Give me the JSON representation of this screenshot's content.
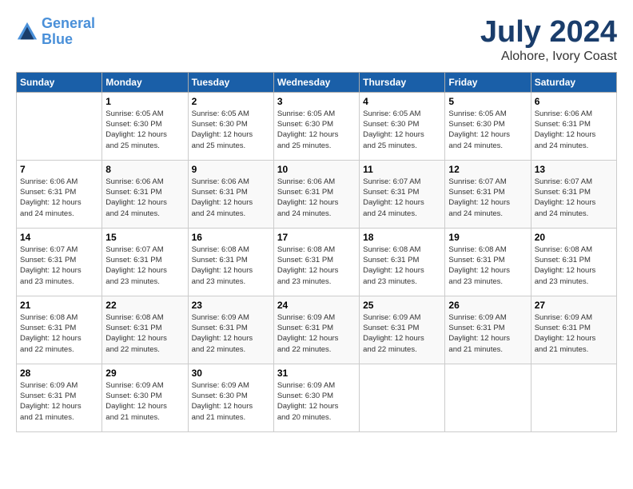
{
  "header": {
    "logo_line1": "General",
    "logo_line2": "Blue",
    "month": "July 2024",
    "location": "Alohore, Ivory Coast"
  },
  "weekdays": [
    "Sunday",
    "Monday",
    "Tuesday",
    "Wednesday",
    "Thursday",
    "Friday",
    "Saturday"
  ],
  "weeks": [
    [
      {
        "day": "",
        "info": ""
      },
      {
        "day": "1",
        "info": "Sunrise: 6:05 AM\nSunset: 6:30 PM\nDaylight: 12 hours\nand 25 minutes."
      },
      {
        "day": "2",
        "info": "Sunrise: 6:05 AM\nSunset: 6:30 PM\nDaylight: 12 hours\nand 25 minutes."
      },
      {
        "day": "3",
        "info": "Sunrise: 6:05 AM\nSunset: 6:30 PM\nDaylight: 12 hours\nand 25 minutes."
      },
      {
        "day": "4",
        "info": "Sunrise: 6:05 AM\nSunset: 6:30 PM\nDaylight: 12 hours\nand 25 minutes."
      },
      {
        "day": "5",
        "info": "Sunrise: 6:05 AM\nSunset: 6:30 PM\nDaylight: 12 hours\nand 24 minutes."
      },
      {
        "day": "6",
        "info": "Sunrise: 6:06 AM\nSunset: 6:31 PM\nDaylight: 12 hours\nand 24 minutes."
      }
    ],
    [
      {
        "day": "7",
        "info": "Sunrise: 6:06 AM\nSunset: 6:31 PM\nDaylight: 12 hours\nand 24 minutes."
      },
      {
        "day": "8",
        "info": "Sunrise: 6:06 AM\nSunset: 6:31 PM\nDaylight: 12 hours\nand 24 minutes."
      },
      {
        "day": "9",
        "info": "Sunrise: 6:06 AM\nSunset: 6:31 PM\nDaylight: 12 hours\nand 24 minutes."
      },
      {
        "day": "10",
        "info": "Sunrise: 6:06 AM\nSunset: 6:31 PM\nDaylight: 12 hours\nand 24 minutes."
      },
      {
        "day": "11",
        "info": "Sunrise: 6:07 AM\nSunset: 6:31 PM\nDaylight: 12 hours\nand 24 minutes."
      },
      {
        "day": "12",
        "info": "Sunrise: 6:07 AM\nSunset: 6:31 PM\nDaylight: 12 hours\nand 24 minutes."
      },
      {
        "day": "13",
        "info": "Sunrise: 6:07 AM\nSunset: 6:31 PM\nDaylight: 12 hours\nand 24 minutes."
      }
    ],
    [
      {
        "day": "14",
        "info": "Sunrise: 6:07 AM\nSunset: 6:31 PM\nDaylight: 12 hours\nand 23 minutes."
      },
      {
        "day": "15",
        "info": "Sunrise: 6:07 AM\nSunset: 6:31 PM\nDaylight: 12 hours\nand 23 minutes."
      },
      {
        "day": "16",
        "info": "Sunrise: 6:08 AM\nSunset: 6:31 PM\nDaylight: 12 hours\nand 23 minutes."
      },
      {
        "day": "17",
        "info": "Sunrise: 6:08 AM\nSunset: 6:31 PM\nDaylight: 12 hours\nand 23 minutes."
      },
      {
        "day": "18",
        "info": "Sunrise: 6:08 AM\nSunset: 6:31 PM\nDaylight: 12 hours\nand 23 minutes."
      },
      {
        "day": "19",
        "info": "Sunrise: 6:08 AM\nSunset: 6:31 PM\nDaylight: 12 hours\nand 23 minutes."
      },
      {
        "day": "20",
        "info": "Sunrise: 6:08 AM\nSunset: 6:31 PM\nDaylight: 12 hours\nand 23 minutes."
      }
    ],
    [
      {
        "day": "21",
        "info": "Sunrise: 6:08 AM\nSunset: 6:31 PM\nDaylight: 12 hours\nand 22 minutes."
      },
      {
        "day": "22",
        "info": "Sunrise: 6:08 AM\nSunset: 6:31 PM\nDaylight: 12 hours\nand 22 minutes."
      },
      {
        "day": "23",
        "info": "Sunrise: 6:09 AM\nSunset: 6:31 PM\nDaylight: 12 hours\nand 22 minutes."
      },
      {
        "day": "24",
        "info": "Sunrise: 6:09 AM\nSunset: 6:31 PM\nDaylight: 12 hours\nand 22 minutes."
      },
      {
        "day": "25",
        "info": "Sunrise: 6:09 AM\nSunset: 6:31 PM\nDaylight: 12 hours\nand 22 minutes."
      },
      {
        "day": "26",
        "info": "Sunrise: 6:09 AM\nSunset: 6:31 PM\nDaylight: 12 hours\nand 21 minutes."
      },
      {
        "day": "27",
        "info": "Sunrise: 6:09 AM\nSunset: 6:31 PM\nDaylight: 12 hours\nand 21 minutes."
      }
    ],
    [
      {
        "day": "28",
        "info": "Sunrise: 6:09 AM\nSunset: 6:31 PM\nDaylight: 12 hours\nand 21 minutes."
      },
      {
        "day": "29",
        "info": "Sunrise: 6:09 AM\nSunset: 6:30 PM\nDaylight: 12 hours\nand 21 minutes."
      },
      {
        "day": "30",
        "info": "Sunrise: 6:09 AM\nSunset: 6:30 PM\nDaylight: 12 hours\nand 21 minutes."
      },
      {
        "day": "31",
        "info": "Sunrise: 6:09 AM\nSunset: 6:30 PM\nDaylight: 12 hours\nand 20 minutes."
      },
      {
        "day": "",
        "info": ""
      },
      {
        "day": "",
        "info": ""
      },
      {
        "day": "",
        "info": ""
      }
    ]
  ]
}
